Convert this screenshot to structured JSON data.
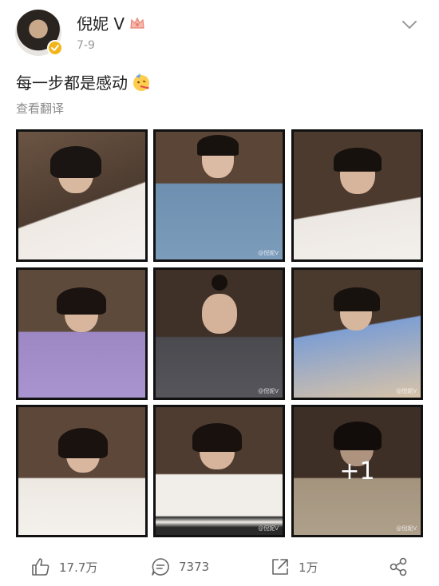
{
  "post": {
    "author": {
      "name": "倪妮 V",
      "avatar": "avatar",
      "verified": true
    },
    "date": "7-9",
    "text": "每一步都是感动",
    "emoji": "partying-face-emoji",
    "translate_label": "查看翻译",
    "images": {
      "count_visible": 9,
      "more_label": "+1",
      "watermark": "@倪妮V"
    }
  },
  "actions": {
    "like_count": "17.7万",
    "comment_count": "7373",
    "repost_count": "1万"
  },
  "colors": {
    "verified": "#f3b51a",
    "text_primary": "#222222",
    "text_secondary": "#999999",
    "icon_gray": "#666666"
  }
}
